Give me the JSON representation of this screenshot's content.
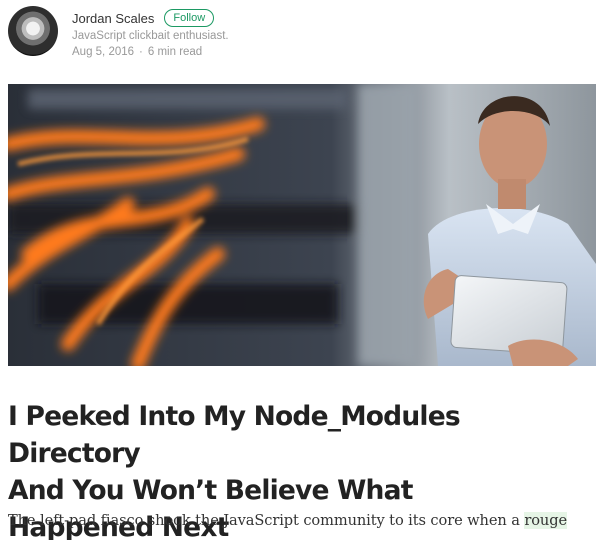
{
  "author": {
    "name": "Jordan Scales",
    "follow_label": "Follow",
    "bio": "JavaScript clickbait enthusiast.",
    "date": "Aug 5, 2016",
    "read_time": "6 min read",
    "separator": "·"
  },
  "hero": {
    "icon": "hero-image"
  },
  "article": {
    "title_lines": [
      "I Peeked Into My Node_Modules Directory",
      "And You Won’t Believe What",
      "Happened Next"
    ],
    "subtitle_before": "The left-pad fiasco shook the JavaScript community to its core when a ",
    "subtitle_highlight": "rouge"
  },
  "colors": {
    "accent": "#1c9963",
    "highlight": "#e6f5e6",
    "meta": "#999999",
    "title": "#222222"
  }
}
